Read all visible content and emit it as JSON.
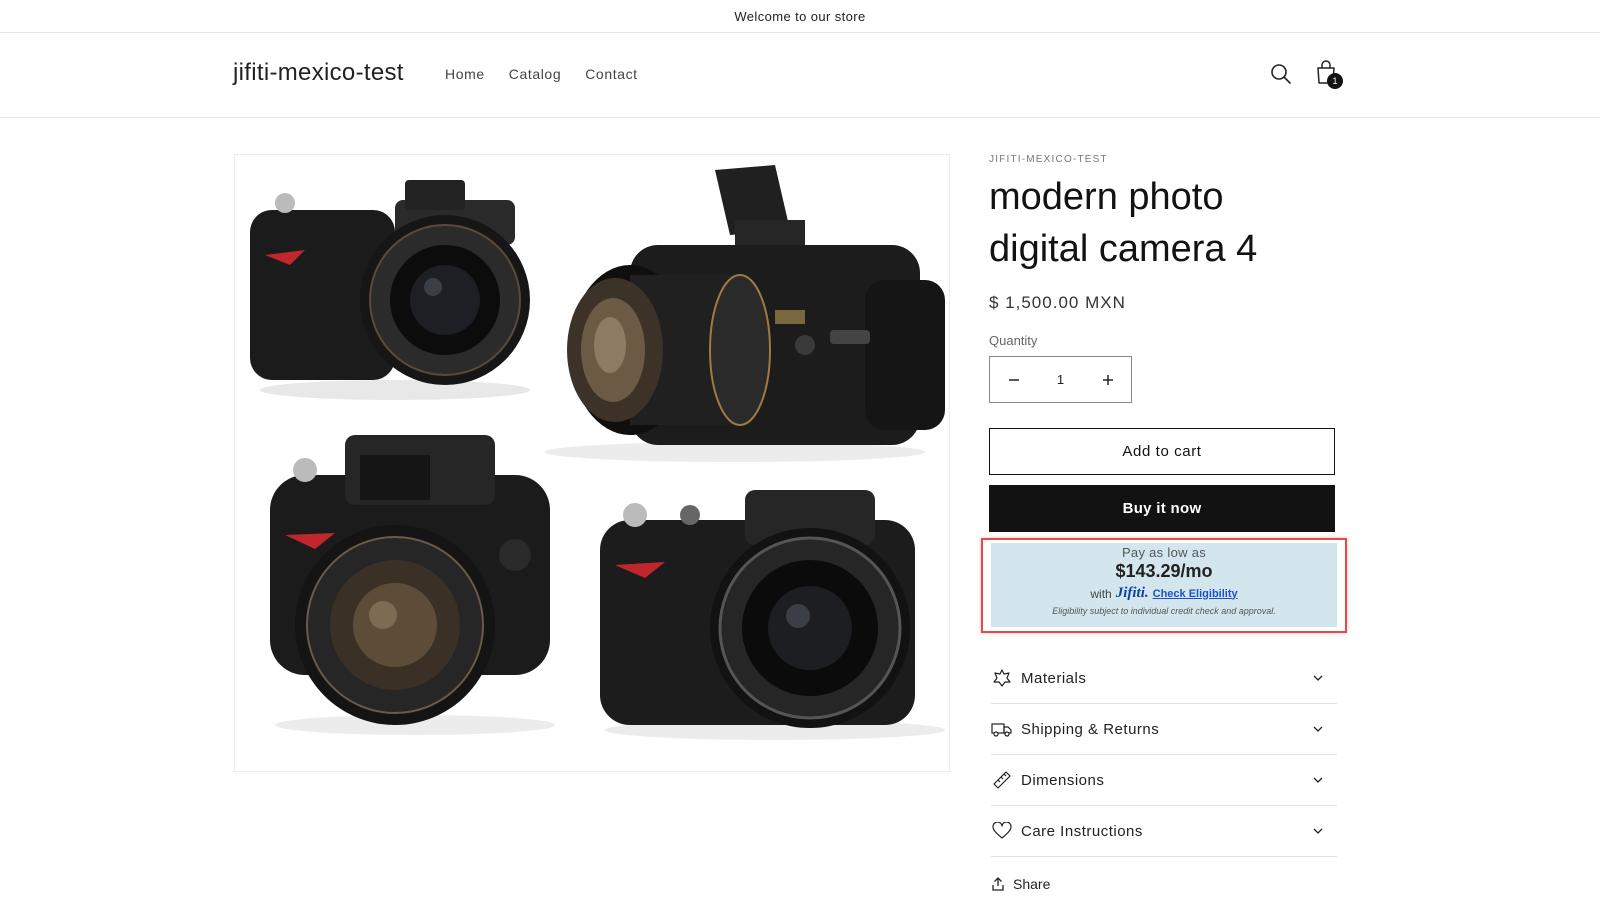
{
  "announcement": {
    "text": "Welcome to our store"
  },
  "header": {
    "logo": "jifiti-mexico-test",
    "nav": [
      "Home",
      "Catalog",
      "Contact"
    ],
    "cart_count": "1",
    "icons": {
      "search": "search-icon",
      "cart": "cart-icon"
    }
  },
  "product": {
    "vendor": "JIFITI-MEXICO-TEST",
    "title_line1": "modern photo",
    "title_line2": "digital camera 4",
    "price": "$ 1,500.00 MXN",
    "quantity_label": "Quantity",
    "quantity_value": "1",
    "add_to_cart": "Add to cart",
    "buy_now": "Buy it now",
    "image": "product-photo-four-black-digital-cameras"
  },
  "jifiti": {
    "line1": "Pay as low as",
    "amount": "$143.29/mo",
    "with": "with",
    "brand": "Jifiti.",
    "link": "Check Eligibility",
    "note": "Eligibility subject to individual credit check and approval.",
    "highlight_color": "#e24c4c",
    "background": "#d3e6ee"
  },
  "accordions": [
    {
      "label": "Materials",
      "icon": "leaf-icon"
    },
    {
      "label": "Shipping & Returns",
      "icon": "truck-icon"
    },
    {
      "label": "Dimensions",
      "icon": "ruler-icon"
    },
    {
      "label": "Care Instructions",
      "icon": "heart-icon"
    }
  ],
  "share": {
    "label": "Share",
    "icon": "share-icon"
  }
}
